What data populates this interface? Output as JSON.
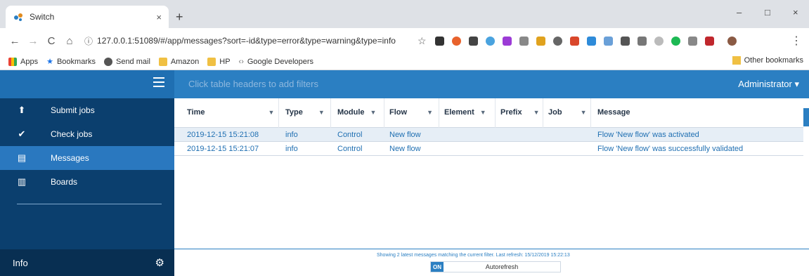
{
  "browser": {
    "tab_title": "Switch",
    "tab_close": "×",
    "new_tab": "+",
    "minimize": "–",
    "maximize": "□",
    "close": "×",
    "url": "127.0.0.1:51089/#/app/messages?sort=-id&type=error&type=warning&type=info",
    "bookmarks": [
      {
        "label": "Apps",
        "icon": "apps-icon"
      },
      {
        "label": "Bookmarks",
        "icon": "star-icon"
      },
      {
        "label": "Send mail",
        "icon": "mail-icon"
      },
      {
        "label": "Amazon",
        "icon": "folder-icon"
      },
      {
        "label": "HP",
        "icon": "folder-icon"
      },
      {
        "label": "Google Developers",
        "icon": "code-icon"
      }
    ],
    "other_bookmarks": "Other bookmarks"
  },
  "sidebar": {
    "items": [
      {
        "label": "Submit jobs",
        "icon": "upload-icon"
      },
      {
        "label": "Check jobs",
        "icon": "check-circle-icon"
      },
      {
        "label": "Messages",
        "icon": "messages-icon",
        "active": true
      },
      {
        "label": "Boards",
        "icon": "boards-icon"
      }
    ],
    "footer_label": "Info"
  },
  "topbar": {
    "filter_hint": "Click table headers to add filters",
    "user": "Administrator"
  },
  "table": {
    "columns": [
      "Time",
      "Type",
      "Module",
      "Flow",
      "Element",
      "Prefix",
      "Job",
      "Message"
    ],
    "rows": [
      {
        "time": "2019-12-15 15:21:08",
        "type": "info",
        "module": "Control",
        "flow": "New flow",
        "element": "",
        "prefix": "",
        "job": "",
        "message": "Flow 'New flow' was activated"
      },
      {
        "time": "2019-12-15 15:21:07",
        "type": "info",
        "module": "Control",
        "flow": "New flow",
        "element": "",
        "prefix": "",
        "job": "",
        "message": "Flow 'New flow' was successfully validated"
      }
    ]
  },
  "footer": {
    "status": "Showing 2 latest messages matching the current filter. Last refresh: 15/12/2019 15:22:13",
    "toggle_on": "ON",
    "toggle_label": "Autorefresh"
  },
  "colors": {
    "sidebar": "#0b3f6e",
    "accent": "#2b7fc2",
    "active_item": "#2a78bf"
  }
}
